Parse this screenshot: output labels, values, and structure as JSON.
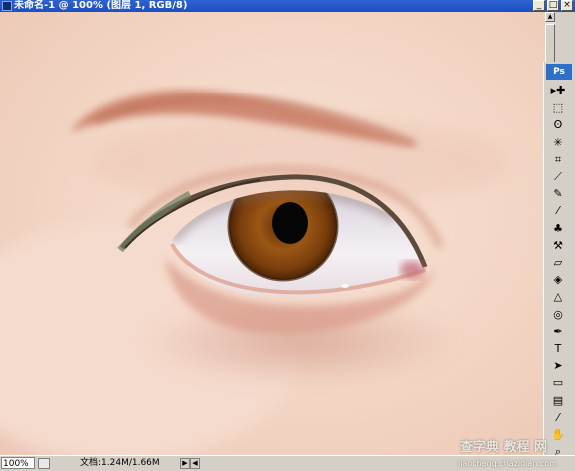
{
  "window": {
    "title": "未命名-1 @ 100% (图层 1, RGB/8)"
  },
  "toolbox": {
    "logo": "Ps",
    "tools": [
      {
        "name": "move-tool-icon",
        "glyph": "▸✚"
      },
      {
        "name": "marquee-tool-icon",
        "glyph": "⬚"
      },
      {
        "name": "lasso-tool-icon",
        "glyph": "ʘ"
      },
      {
        "name": "magic-wand-tool-icon",
        "glyph": "✳"
      },
      {
        "name": "crop-tool-icon",
        "glyph": "⌗"
      },
      {
        "name": "eyedropper-slice-tool-icon",
        "glyph": "⟋"
      },
      {
        "name": "healing-brush-tool-icon",
        "glyph": "✎"
      },
      {
        "name": "brush-tool-icon",
        "glyph": "⁄"
      },
      {
        "name": "clone-stamp-tool-icon",
        "glyph": "♣"
      },
      {
        "name": "history-brush-tool-icon",
        "glyph": "⚒"
      },
      {
        "name": "eraser-tool-icon",
        "glyph": "▱"
      },
      {
        "name": "paint-bucket-tool-icon",
        "glyph": "◈"
      },
      {
        "name": "blur-tool-icon",
        "glyph": "△"
      },
      {
        "name": "dodge-tool-icon",
        "glyph": "◎"
      },
      {
        "name": "pen-tool-icon",
        "glyph": "✒"
      },
      {
        "name": "type-tool-icon",
        "glyph": "T"
      },
      {
        "name": "path-selection-tool-icon",
        "glyph": "➤"
      },
      {
        "name": "shape-tool-icon",
        "glyph": "▭"
      },
      {
        "name": "notes-tool-icon",
        "glyph": "▤"
      },
      {
        "name": "eyedropper-tool-icon",
        "glyph": "⁄"
      },
      {
        "name": "hand-tool-icon",
        "glyph": "✋"
      },
      {
        "name": "zoom-tool-icon",
        "glyph": "⌕"
      }
    ]
  },
  "statusbar": {
    "zoom": "100%",
    "doc_info": "文档:1.24M/1.66M",
    "watermark": "查字典 教程 网",
    "watermark_url": "jiaocheng.chazidian.com"
  },
  "colors": {
    "titlebar": "#1f53c6",
    "skin": "#f3d7c8",
    "iris": "#8a4a12",
    "chrome": "#d4d0c8"
  }
}
